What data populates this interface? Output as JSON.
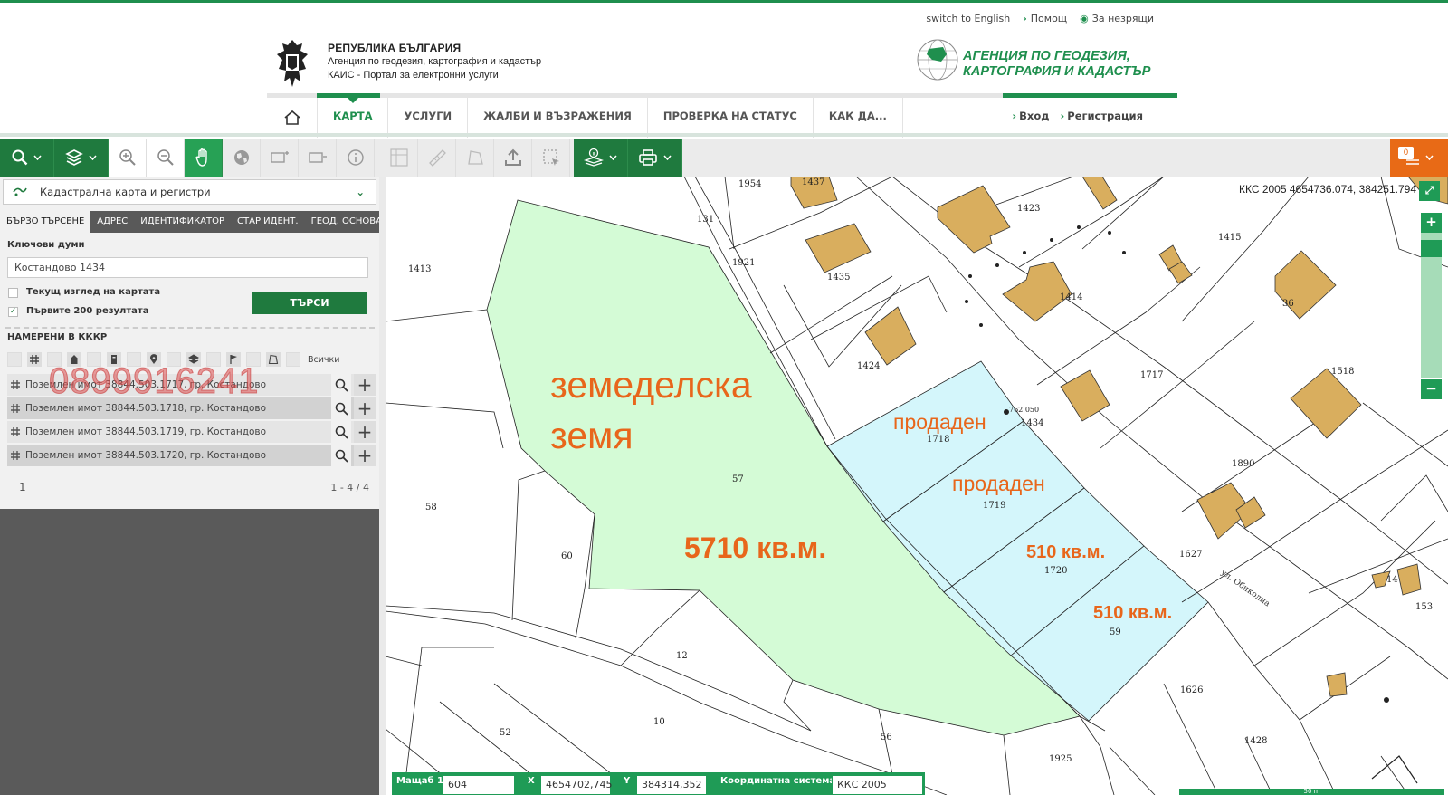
{
  "header": {
    "switch_language": "switch to English",
    "help": "Помощ",
    "visually_impaired": "За незрящи",
    "logo_line1": "РЕПУБЛИКА БЪЛГАРИЯ",
    "logo_line2": "Агенция по геодезия, картография и кадастър",
    "logo_line3": "КАИС - Портал за електронни услуги",
    "agency_line1": "АГЕНЦИЯ ПО ГЕОДЕЗИЯ,",
    "agency_line2": "КАРТОГРАФИЯ И КАДАСТЪР"
  },
  "nav": {
    "items": [
      {
        "label": "КАРТА"
      },
      {
        "label": "УСЛУГИ"
      },
      {
        "label": "ЖАЛБИ И ВЪЗРАЖЕНИЯ"
      },
      {
        "label": "ПРОВЕРКА НА СТАТУС"
      },
      {
        "label": "КАК ДА..."
      }
    ],
    "login": "Вход",
    "register": "Регистрация"
  },
  "toolbar": {
    "counter": "0"
  },
  "panel": {
    "layer_select": "Кадастрална карта и регистри",
    "tabs": [
      {
        "label": "БЪРЗО ТЪРСЕНЕ"
      },
      {
        "label": "АДРЕС"
      },
      {
        "label": "ИДЕНТИФИКАТОР"
      },
      {
        "label": "СТАР ИДЕНТ."
      },
      {
        "label": "ГЕОД. ОСНОВА"
      }
    ],
    "keywords_label": "Ключови думи",
    "keywords_value": "Костандово 1434",
    "current_view_label": "Текущ изглед на картата",
    "first_200_label": "Първите 200 резултата",
    "search_button": "ТЪРСИ",
    "found_label": "НАМЕРЕНИ В КККР",
    "all_label": "Всички",
    "results": [
      {
        "label": "Поземлен имот 38844.503.1717, гр. Костандово"
      },
      {
        "label": "Поземлен имот 38844.503.1718, гр. Костандово"
      },
      {
        "label": "Поземлен имот 38844.503.1719, гр. Костандово"
      },
      {
        "label": "Поземлен имот 38844.503.1720, гр. Костандово"
      }
    ],
    "page": "1",
    "page_count": "1 - 4 / 4",
    "phone_watermark": "0899916241"
  },
  "map": {
    "coord_readout": "ККС 2005 4654736.074, 384251.794",
    "overlay_land_line1": "земеделска",
    "overlay_land_line2": "земя",
    "overlay_area_big": "5710 кв.м.",
    "overlay_sold_1": "продаден",
    "overlay_sold_2": "продаден",
    "overlay_area_1719": "510 кв.м.",
    "overlay_area_1720": "510 кв.м.",
    "street_name": "ул. Обиколна",
    "scale_text": "50 m",
    "parcel_labels": [
      "1954",
      "1437",
      "1423",
      "1415",
      "131",
      "1921",
      "1435",
      "1424",
      "1414",
      "36",
      "1413",
      "1518",
      "1717",
      "1718",
      "1719",
      "1720",
      "59",
      "57",
      "58",
      "60",
      "12",
      "10",
      "52",
      "56",
      "1925",
      "1890",
      "1627",
      "1626",
      "1428",
      "14",
      "153",
      "762.050",
      "1434",
      "1"
    ]
  },
  "bottom": {
    "scale_label": "Мащаб",
    "scale_prefix": "1:",
    "scale_value": "604",
    "x_label": "X",
    "x_value": "4654702,745",
    "y_label": "Y",
    "y_value": "384314,352",
    "crs_label": "Координатна система",
    "crs_value": "ККС 2005"
  },
  "colors": {
    "brand_green": "#1f7a3e",
    "accent_green": "#1f9b56",
    "orange": "#e86a16",
    "land_fill": "#d4fbd6",
    "sold_fill": "#d4f6fb",
    "building_fill": "#d9ae5e"
  }
}
